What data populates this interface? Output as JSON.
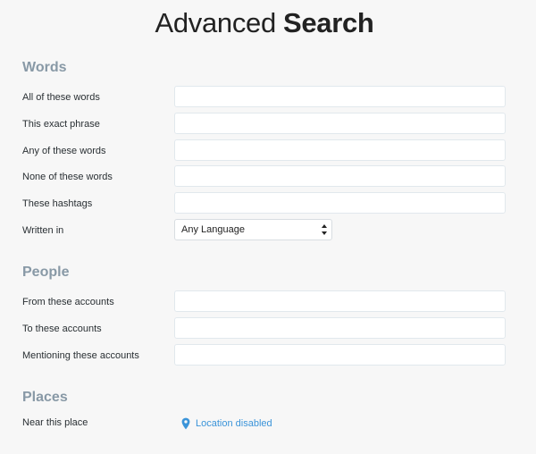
{
  "header": {
    "title_light": "Advanced",
    "title_bold": "Search"
  },
  "sections": {
    "words": {
      "heading": "Words",
      "all_words": {
        "label": "All of these words",
        "value": ""
      },
      "exact_phrase": {
        "label": "This exact phrase",
        "value": ""
      },
      "any_words": {
        "label": "Any of these words",
        "value": ""
      },
      "none_words": {
        "label": "None of these words",
        "value": ""
      },
      "hashtags": {
        "label": "These hashtags",
        "value": ""
      },
      "language": {
        "label": "Written in",
        "selected": "Any Language"
      }
    },
    "people": {
      "heading": "People",
      "from_accounts": {
        "label": "From these accounts",
        "value": ""
      },
      "to_accounts": {
        "label": "To these accounts",
        "value": ""
      },
      "mentioning_accounts": {
        "label": "Mentioning these accounts",
        "value": ""
      }
    },
    "places": {
      "heading": "Places",
      "near_place": {
        "label": "Near this place",
        "status": "Location disabled"
      }
    }
  },
  "icons": {
    "location": "map-pin-icon",
    "select_arrows": "select-arrows-icon"
  },
  "colors": {
    "heading": "#8899a6",
    "link": "#3b94d9",
    "pin": "#3b94d9"
  }
}
